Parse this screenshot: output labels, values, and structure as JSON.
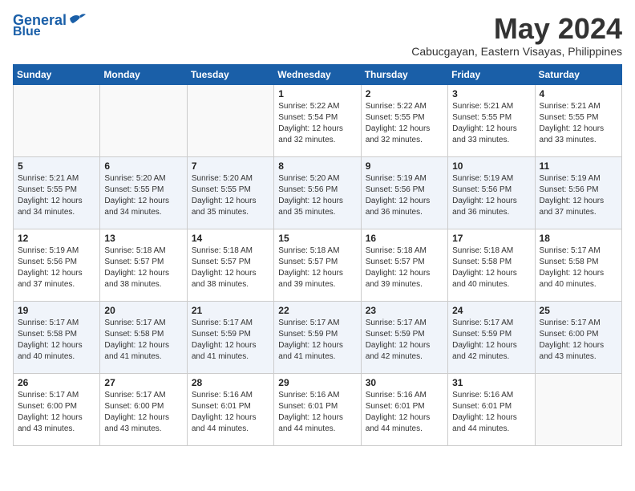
{
  "header": {
    "logo_line1": "General",
    "logo_line2": "Blue",
    "month_title": "May 2024",
    "location": "Cabucgayan, Eastern Visayas, Philippines"
  },
  "days_of_week": [
    "Sunday",
    "Monday",
    "Tuesday",
    "Wednesday",
    "Thursday",
    "Friday",
    "Saturday"
  ],
  "weeks": [
    [
      {
        "day": "",
        "info": ""
      },
      {
        "day": "",
        "info": ""
      },
      {
        "day": "",
        "info": ""
      },
      {
        "day": "1",
        "info": "Sunrise: 5:22 AM\nSunset: 5:54 PM\nDaylight: 12 hours\nand 32 minutes."
      },
      {
        "day": "2",
        "info": "Sunrise: 5:22 AM\nSunset: 5:55 PM\nDaylight: 12 hours\nand 32 minutes."
      },
      {
        "day": "3",
        "info": "Sunrise: 5:21 AM\nSunset: 5:55 PM\nDaylight: 12 hours\nand 33 minutes."
      },
      {
        "day": "4",
        "info": "Sunrise: 5:21 AM\nSunset: 5:55 PM\nDaylight: 12 hours\nand 33 minutes."
      }
    ],
    [
      {
        "day": "5",
        "info": "Sunrise: 5:21 AM\nSunset: 5:55 PM\nDaylight: 12 hours\nand 34 minutes."
      },
      {
        "day": "6",
        "info": "Sunrise: 5:20 AM\nSunset: 5:55 PM\nDaylight: 12 hours\nand 34 minutes."
      },
      {
        "day": "7",
        "info": "Sunrise: 5:20 AM\nSunset: 5:55 PM\nDaylight: 12 hours\nand 35 minutes."
      },
      {
        "day": "8",
        "info": "Sunrise: 5:20 AM\nSunset: 5:56 PM\nDaylight: 12 hours\nand 35 minutes."
      },
      {
        "day": "9",
        "info": "Sunrise: 5:19 AM\nSunset: 5:56 PM\nDaylight: 12 hours\nand 36 minutes."
      },
      {
        "day": "10",
        "info": "Sunrise: 5:19 AM\nSunset: 5:56 PM\nDaylight: 12 hours\nand 36 minutes."
      },
      {
        "day": "11",
        "info": "Sunrise: 5:19 AM\nSunset: 5:56 PM\nDaylight: 12 hours\nand 37 minutes."
      }
    ],
    [
      {
        "day": "12",
        "info": "Sunrise: 5:19 AM\nSunset: 5:56 PM\nDaylight: 12 hours\nand 37 minutes."
      },
      {
        "day": "13",
        "info": "Sunrise: 5:18 AM\nSunset: 5:57 PM\nDaylight: 12 hours\nand 38 minutes."
      },
      {
        "day": "14",
        "info": "Sunrise: 5:18 AM\nSunset: 5:57 PM\nDaylight: 12 hours\nand 38 minutes."
      },
      {
        "day": "15",
        "info": "Sunrise: 5:18 AM\nSunset: 5:57 PM\nDaylight: 12 hours\nand 39 minutes."
      },
      {
        "day": "16",
        "info": "Sunrise: 5:18 AM\nSunset: 5:57 PM\nDaylight: 12 hours\nand 39 minutes."
      },
      {
        "day": "17",
        "info": "Sunrise: 5:18 AM\nSunset: 5:58 PM\nDaylight: 12 hours\nand 40 minutes."
      },
      {
        "day": "18",
        "info": "Sunrise: 5:17 AM\nSunset: 5:58 PM\nDaylight: 12 hours\nand 40 minutes."
      }
    ],
    [
      {
        "day": "19",
        "info": "Sunrise: 5:17 AM\nSunset: 5:58 PM\nDaylight: 12 hours\nand 40 minutes."
      },
      {
        "day": "20",
        "info": "Sunrise: 5:17 AM\nSunset: 5:58 PM\nDaylight: 12 hours\nand 41 minutes."
      },
      {
        "day": "21",
        "info": "Sunrise: 5:17 AM\nSunset: 5:59 PM\nDaylight: 12 hours\nand 41 minutes."
      },
      {
        "day": "22",
        "info": "Sunrise: 5:17 AM\nSunset: 5:59 PM\nDaylight: 12 hours\nand 41 minutes."
      },
      {
        "day": "23",
        "info": "Sunrise: 5:17 AM\nSunset: 5:59 PM\nDaylight: 12 hours\nand 42 minutes."
      },
      {
        "day": "24",
        "info": "Sunrise: 5:17 AM\nSunset: 5:59 PM\nDaylight: 12 hours\nand 42 minutes."
      },
      {
        "day": "25",
        "info": "Sunrise: 5:17 AM\nSunset: 6:00 PM\nDaylight: 12 hours\nand 43 minutes."
      }
    ],
    [
      {
        "day": "26",
        "info": "Sunrise: 5:17 AM\nSunset: 6:00 PM\nDaylight: 12 hours\nand 43 minutes."
      },
      {
        "day": "27",
        "info": "Sunrise: 5:17 AM\nSunset: 6:00 PM\nDaylight: 12 hours\nand 43 minutes."
      },
      {
        "day": "28",
        "info": "Sunrise: 5:16 AM\nSunset: 6:01 PM\nDaylight: 12 hours\nand 44 minutes."
      },
      {
        "day": "29",
        "info": "Sunrise: 5:16 AM\nSunset: 6:01 PM\nDaylight: 12 hours\nand 44 minutes."
      },
      {
        "day": "30",
        "info": "Sunrise: 5:16 AM\nSunset: 6:01 PM\nDaylight: 12 hours\nand 44 minutes."
      },
      {
        "day": "31",
        "info": "Sunrise: 5:16 AM\nSunset: 6:01 PM\nDaylight: 12 hours\nand 44 minutes."
      },
      {
        "day": "",
        "info": ""
      }
    ]
  ]
}
